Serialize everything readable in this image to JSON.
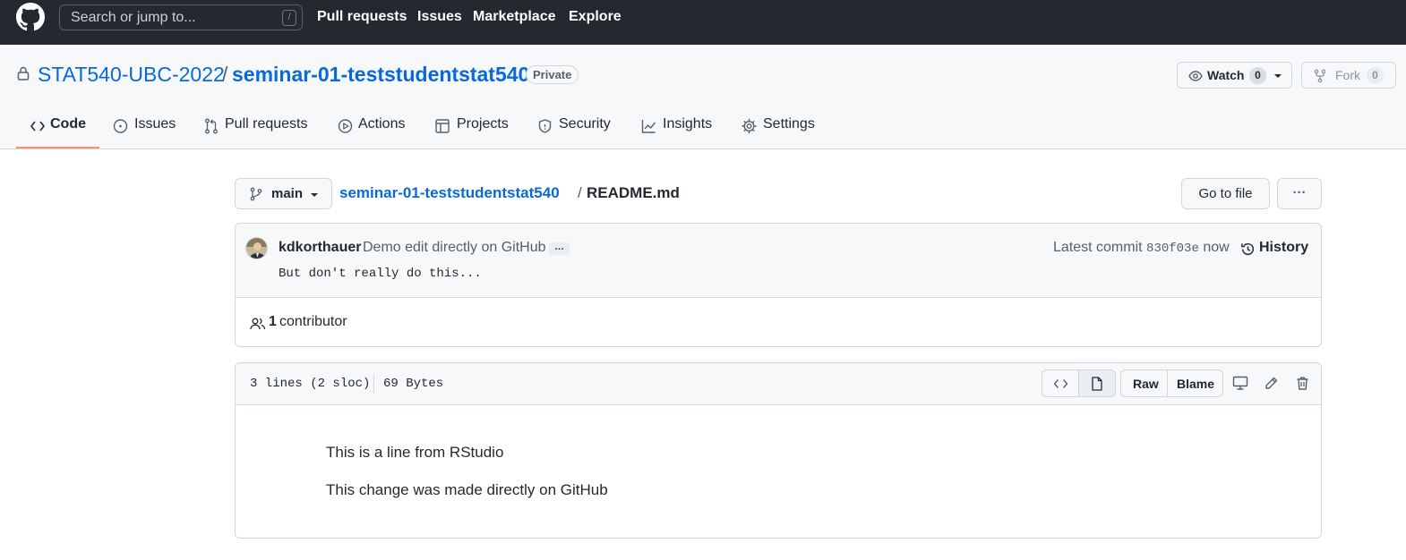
{
  "header": {
    "search_placeholder": "Search or jump to...",
    "search_shortcut": "/",
    "nav": [
      "Pull requests",
      "Issues",
      "Marketplace",
      "Explore"
    ]
  },
  "repo": {
    "owner": "STAT540-UBC-2022",
    "separator": "/",
    "name": "seminar-01-teststudentstat540",
    "visibility": "Private",
    "watch_label": "Watch",
    "watch_count": "0",
    "fork_label": "Fork",
    "fork_count": "0"
  },
  "tabs": [
    {
      "label": "Code",
      "icon": "code-icon",
      "active": true
    },
    {
      "label": "Issues",
      "icon": "issue-icon"
    },
    {
      "label": "Pull requests",
      "icon": "pull-request-icon"
    },
    {
      "label": "Actions",
      "icon": "play-icon"
    },
    {
      "label": "Projects",
      "icon": "table-icon"
    },
    {
      "label": "Security",
      "icon": "shield-icon"
    },
    {
      "label": "Insights",
      "icon": "graph-icon"
    },
    {
      "label": "Settings",
      "icon": "gear-icon"
    }
  ],
  "file_nav": {
    "branch": "main",
    "crumb_repo": "seminar-01-teststudentstat540",
    "crumb_sep": "/",
    "file_name": "README.md",
    "goto_label": "Go to file",
    "more_label": "···"
  },
  "commit": {
    "author": "kdkorthauer",
    "message": "Demo edit directly on GitHub",
    "expand_label": "…",
    "body": "But don't really do this...",
    "latest_label": "Latest commit",
    "sha": "830f03e",
    "time": "now",
    "history_label": "History",
    "contributors_count": "1",
    "contributors_label": "contributor"
  },
  "file": {
    "lines_info": "3 lines (2 sloc)",
    "size": "69 Bytes",
    "raw_label": "Raw",
    "blame_label": "Blame",
    "content": [
      "This is a line from RStudio",
      "This change was made directly on GitHub"
    ]
  },
  "colors": {
    "header_bg": "#24292f",
    "link": "#0969da",
    "active_tab_underline": "#fd8c73",
    "subtle_bg": "#f6f8fa",
    "border": "#d0d7de"
  }
}
